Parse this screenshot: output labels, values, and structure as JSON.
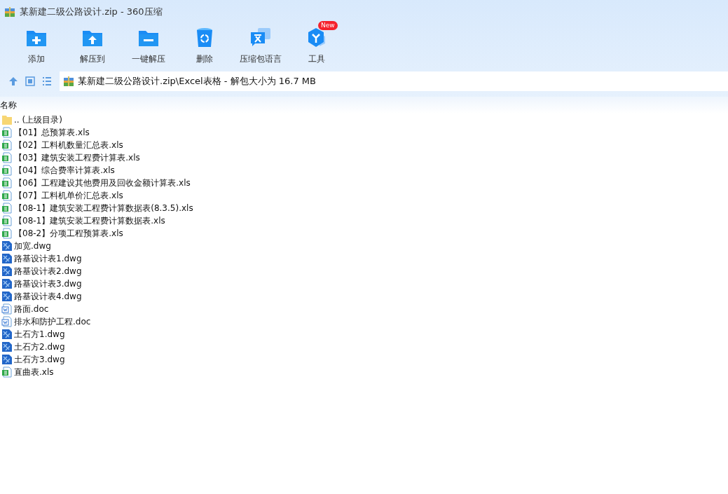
{
  "window": {
    "title": "某新建二级公路设计.zip - 360压缩"
  },
  "toolbar": [
    {
      "label": "添加",
      "kind": "add"
    },
    {
      "label": "解压到",
      "kind": "extract"
    },
    {
      "label": "一键解压",
      "kind": "quick"
    },
    {
      "label": "删除",
      "kind": "delete"
    },
    {
      "label": "压缩包语言",
      "kind": "language"
    },
    {
      "label": "工具",
      "kind": "tools",
      "badge": "New"
    }
  ],
  "address": {
    "path": "某新建二级公路设计.zip\\Excel表格 - 解包大小为 16.7 MB"
  },
  "list": {
    "columns": [
      "名称"
    ],
    "rows": [
      {
        "name": ".. (上级目录)",
        "kind": "folder"
      },
      {
        "name": "【01】总预算表.xls",
        "kind": "xls"
      },
      {
        "name": "【02】工料机数量汇总表.xls",
        "kind": "xls"
      },
      {
        "name": "【03】建筑安装工程费计算表.xls",
        "kind": "xls"
      },
      {
        "name": "【04】综合费率计算表.xls",
        "kind": "xls"
      },
      {
        "name": "【06】工程建设其他费用及回收金额计算表.xls",
        "kind": "xls"
      },
      {
        "name": "【07】工料机单价汇总表.xls",
        "kind": "xls"
      },
      {
        "name": "【08-1】建筑安装工程费计算数据表(8.3.5).xls",
        "kind": "xls"
      },
      {
        "name": "【08-1】建筑安装工程费计算数据表.xls",
        "kind": "xls"
      },
      {
        "name": "【08-2】分项工程预算表.xls",
        "kind": "xls"
      },
      {
        "name": "加宽.dwg",
        "kind": "dwg"
      },
      {
        "name": "路基设计表1.dwg",
        "kind": "dwg"
      },
      {
        "name": "路基设计表2.dwg",
        "kind": "dwg"
      },
      {
        "name": "路基设计表3.dwg",
        "kind": "dwg"
      },
      {
        "name": "路基设计表4.dwg",
        "kind": "dwg"
      },
      {
        "name": "路面.doc",
        "kind": "doc"
      },
      {
        "name": "排水和防护工程.doc",
        "kind": "doc"
      },
      {
        "name": "土石方1.dwg",
        "kind": "dwg"
      },
      {
        "name": "土石方2.dwg",
        "kind": "dwg"
      },
      {
        "name": "土石方3.dwg",
        "kind": "dwg"
      },
      {
        "name": "直曲表.xls",
        "kind": "xls"
      }
    ]
  }
}
